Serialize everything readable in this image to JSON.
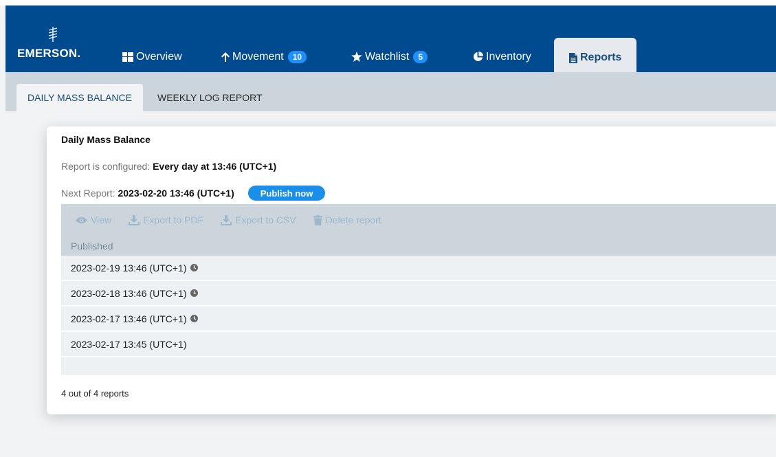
{
  "brand": {
    "name": "EMERSON",
    "dot": "."
  },
  "nav": {
    "items": [
      {
        "label": "Overview",
        "icon": "grid-icon"
      },
      {
        "label": "Movement",
        "icon": "arrow-up-icon",
        "badge": "10"
      },
      {
        "label": "Watchlist",
        "icon": "star-icon",
        "badge": "5"
      },
      {
        "label": "Inventory",
        "icon": "pie-chart-icon"
      },
      {
        "label": "Reports",
        "icon": "document-icon",
        "active": true
      }
    ]
  },
  "subtabs": [
    {
      "label": "DAILY MASS BALANCE",
      "active": true
    },
    {
      "label": "WEEKLY LOG REPORT"
    }
  ],
  "report": {
    "title": "Daily Mass Balance",
    "configured_label": "Report is configured:",
    "configured_value": "Every day at 13:46 (UTC+1)",
    "next_label": "Next Report:",
    "next_value": "2023-02-20 13:46 (UTC+1)",
    "publish_label": "Publish now"
  },
  "toolbar": {
    "view": "View",
    "export_pdf": "Export to PDF",
    "export_csv": "Export to CSV",
    "delete": "Delete report"
  },
  "table": {
    "header": "Published",
    "rows": [
      {
        "published": "2023-02-19 13:46 (UTC+1)",
        "clock": true
      },
      {
        "published": "2023-02-18 13:46 (UTC+1)",
        "clock": true
      },
      {
        "published": "2023-02-17 13:46 (UTC+1)",
        "clock": true
      },
      {
        "published": "2023-02-17 13:45 (UTC+1)",
        "clock": false
      }
    ]
  },
  "footer": {
    "count": "4 out of 4 reports"
  },
  "colors": {
    "navbar": "#004a8f",
    "badge": "#1e90ff",
    "publish": "#1a8fea",
    "toolbar_disabled": "#9fb7cc",
    "subtab_bar": "#ccd5dc"
  }
}
